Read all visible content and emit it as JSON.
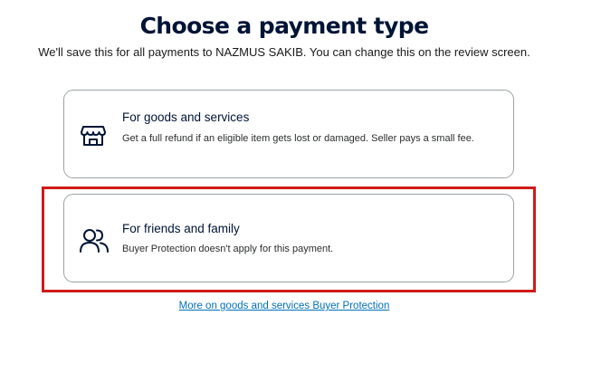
{
  "header": {
    "title": "Choose a payment type",
    "subtitle": "We'll save this for all payments to NAZMUS SAKIB. You can change this on the review screen."
  },
  "options": [
    {
      "icon": "storefront-icon",
      "title": "For goods and services",
      "description": "Get a full refund if an eligible item gets lost or damaged. Seller pays a small fee."
    },
    {
      "icon": "people-icon",
      "title": "For friends and family",
      "description": "Buyer Protection doesn't apply for this payment."
    }
  ],
  "footer": {
    "link_label": "More on goods and services Buyer Protection"
  },
  "colors": {
    "text_primary": "#001435",
    "card_border": "#9da3a6",
    "highlight": "#d11a1a",
    "link": "#0070ba"
  }
}
